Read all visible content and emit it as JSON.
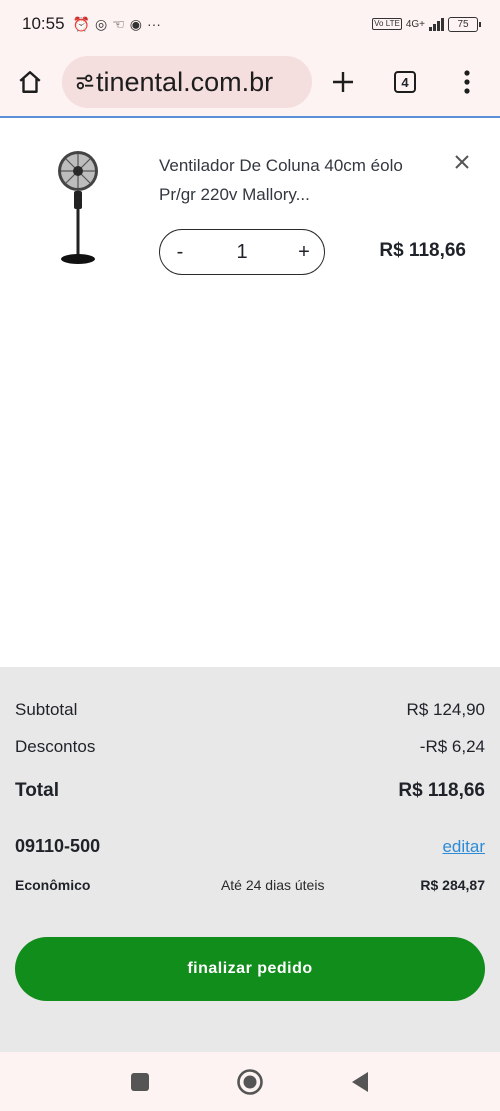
{
  "status_bar": {
    "time": "10:55",
    "more": "···",
    "network": "4G+",
    "volte": "Vo LTE",
    "battery": "75"
  },
  "browser": {
    "url": "tinental.com.br",
    "tab_count": "4"
  },
  "cart": {
    "item": {
      "name": "Ventilador De Coluna 40cm éolo Pr/gr 220v Mallory...",
      "quantity": "1",
      "minus": "-",
      "plus": "+",
      "price": "R$ 118,66"
    }
  },
  "summary": {
    "subtotal_label": "Subtotal",
    "subtotal_value": "R$ 124,90",
    "discount_label": "Descontos",
    "discount_value": "-R$ 6,24",
    "total_label": "Total",
    "total_value": "R$ 118,66",
    "cep": "09110-500",
    "edit_label": "editar",
    "shipping": {
      "name": "Econômico",
      "time": "Até 24 dias úteis",
      "price": "R$ 284,87"
    },
    "checkout_label": "finalizar pedido"
  },
  "colors": {
    "checkout_green": "#118d1c",
    "link_blue": "#2e8bd6",
    "summary_bg": "#e8e8e8",
    "chrome_bg": "#fdf3f2"
  }
}
